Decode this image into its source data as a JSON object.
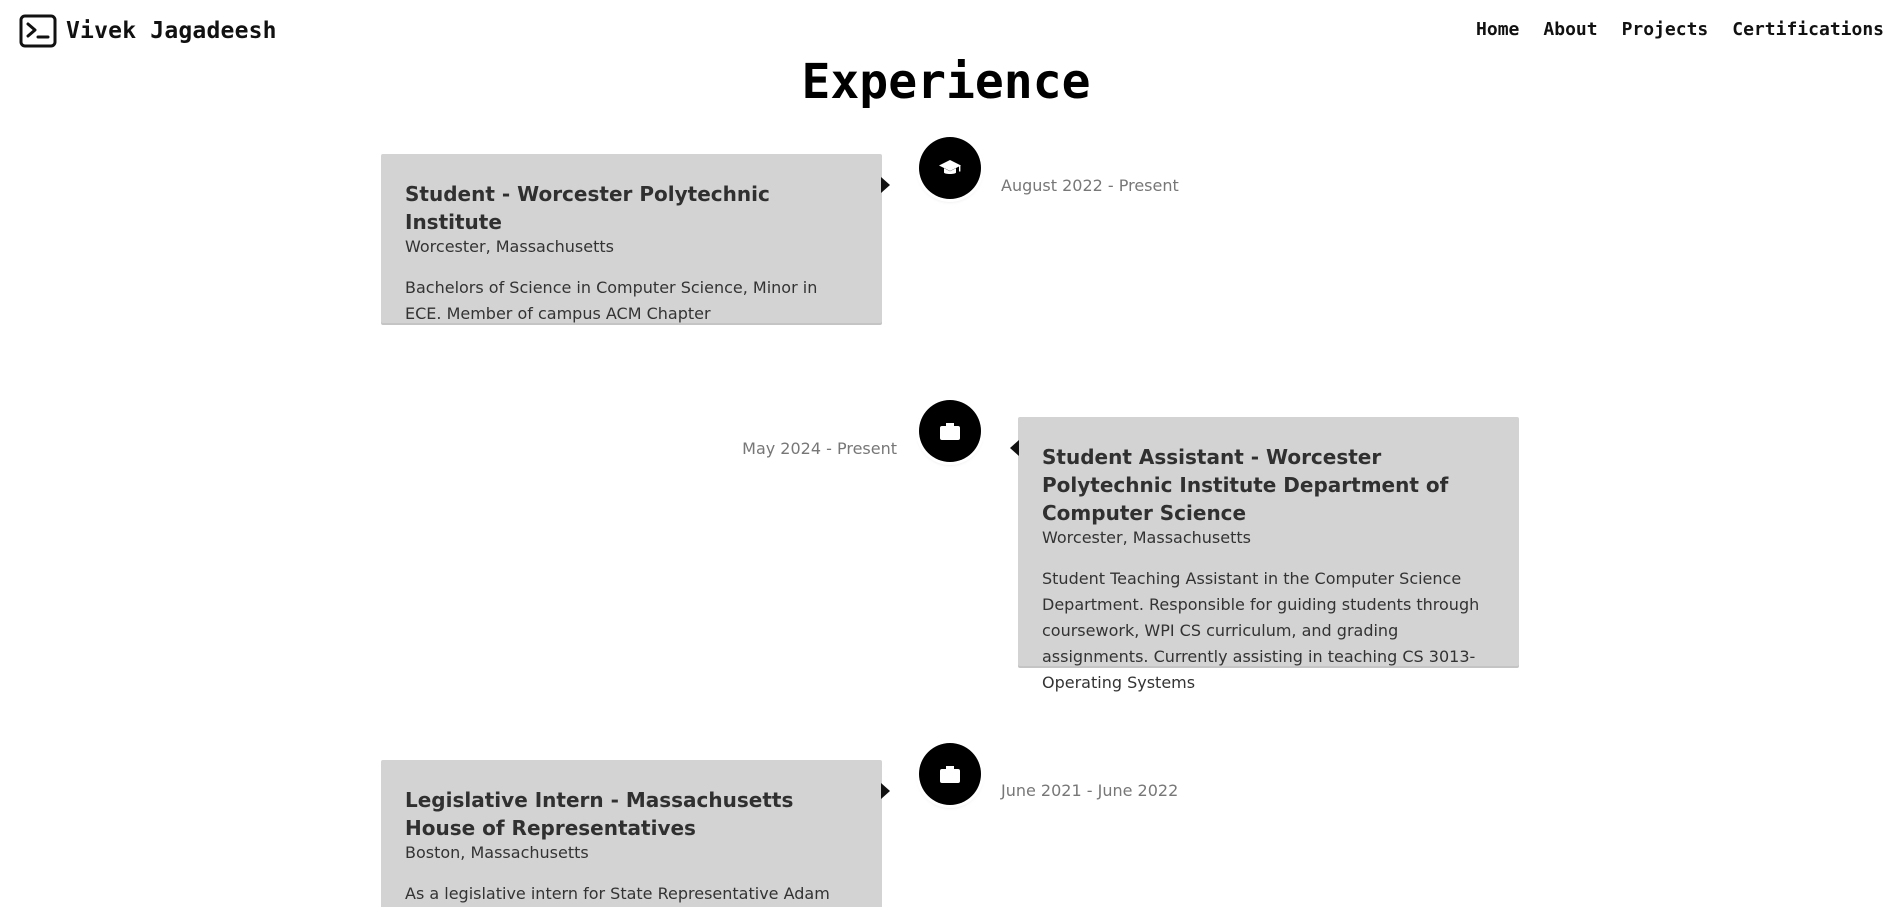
{
  "header": {
    "brand_name": "Vivek Jagadeesh",
    "nav": [
      "Home",
      "About",
      "Projects",
      "Certifications"
    ]
  },
  "page_title": "Experience",
  "timeline": [
    {
      "icon": "graduation-cap-icon",
      "date": "August 2022 - Present",
      "title": "Student - Worcester Polytechnic Institute",
      "location": "Worcester, Massachusetts",
      "description": "Bachelors of Science in Computer Science, Minor in ECE. Member of campus ACM Chapter"
    },
    {
      "icon": "briefcase-icon",
      "date": "May 2024 - Present",
      "title": "Student Assistant - Worcester Polytechnic Institute Department of Computer Science",
      "location": "Worcester, Massachusetts",
      "description": "Student Teaching Assistant in the Computer Science Department. Responsible for guiding students through coursework, WPI CS curriculum, and grading assignments. Currently assisting in teaching CS 3013- Operating Systems"
    },
    {
      "icon": "briefcase-icon",
      "date": "June 2021 - June 2022",
      "title": "Legislative Intern - Massachusetts House of Representatives",
      "location": "Boston, Massachusetts",
      "description": "As a legislative intern for State Representative Adam Scanlon,"
    }
  ]
}
